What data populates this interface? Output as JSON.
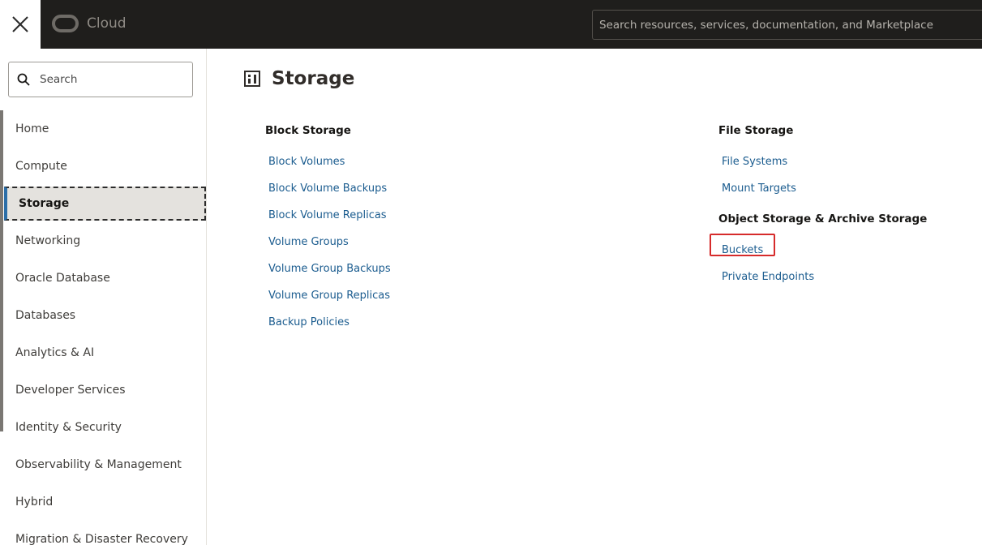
{
  "header": {
    "close_label": "Close",
    "brand": "Cloud",
    "search_placeholder": "Search resources, services, documentation, and Marketplace"
  },
  "sidebar": {
    "search_placeholder": "Search",
    "items": [
      {
        "label": "Home"
      },
      {
        "label": "Compute"
      },
      {
        "label": "Storage",
        "active": true
      },
      {
        "label": "Networking"
      },
      {
        "label": "Oracle Database"
      },
      {
        "label": "Databases"
      },
      {
        "label": "Analytics & AI"
      },
      {
        "label": "Developer Services"
      },
      {
        "label": "Identity & Security"
      },
      {
        "label": "Observability & Management"
      },
      {
        "label": "Hybrid"
      },
      {
        "label": "Migration & Disaster Recovery"
      }
    ]
  },
  "main": {
    "title": "Storage",
    "title_icon": "storage-icon",
    "block_storage": {
      "heading": "Block Storage",
      "links": [
        "Block Volumes",
        "Block Volume Backups",
        "Block Volume Replicas",
        "Volume Groups",
        "Volume Group Backups",
        "Volume Group Replicas",
        "Backup Policies"
      ]
    },
    "file_storage": {
      "heading": "File Storage",
      "links": [
        "File Systems",
        "Mount Targets"
      ]
    },
    "object_storage": {
      "heading": "Object Storage & Archive Storage",
      "links": [
        "Buckets",
        "Private Endpoints"
      ],
      "highlighted": "Buckets"
    }
  },
  "colors": {
    "topbar": "#1f1e1c",
    "link": "#1b5c8f",
    "highlight": "#d62b2b",
    "active_nav_bg": "#e4e2de"
  }
}
